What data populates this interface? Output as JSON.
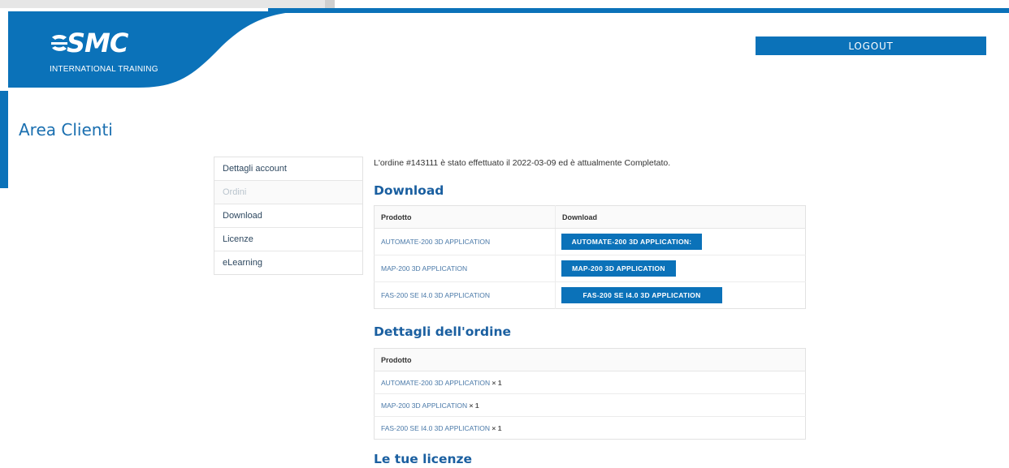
{
  "header": {
    "logo_text": "SMC",
    "logo_subtitle": "INTERNATIONAL TRAINING",
    "logout_label": "LOGOUT"
  },
  "page_title": "Area Clienti",
  "sidebar": {
    "items": [
      {
        "label": "Dettagli account"
      },
      {
        "label": "Ordini"
      },
      {
        "label": "Download"
      },
      {
        "label": "Licenze"
      },
      {
        "label": "eLearning"
      }
    ]
  },
  "order": {
    "prefix": "L'ordine #",
    "number": "143111",
    "middle": " è stato effettuato il ",
    "date": "2022-03-09",
    "middle2": " ed è attualmente ",
    "status": "Completato",
    "suffix": "."
  },
  "download": {
    "title": "Download",
    "columns": [
      "Prodotto",
      "Download"
    ],
    "rows": [
      {
        "product": "AUTOMATE-200 3D APPLICATION",
        "button": "AUTOMATE-200 3D APPLICATION:"
      },
      {
        "product": "MAP-200 3D APPLICATION",
        "button": "MAP-200 3D APPLICATION"
      },
      {
        "product": "FAS-200 SE I4.0 3D APPLICATION",
        "button": "FAS-200 SE I4.0 3D APPLICATION"
      }
    ]
  },
  "details": {
    "title": "Dettagli dell'ordine",
    "column": "Prodotto",
    "rows": [
      {
        "product": "AUTOMATE-200 3D APPLICATION",
        "qty": "× 1"
      },
      {
        "product": "MAP-200 3D APPLICATION",
        "qty": "× 1"
      },
      {
        "product": "FAS-200 SE I4.0 3D APPLICATION",
        "qty": "× 1"
      }
    ]
  },
  "licenses": {
    "title": "Le tue licenze"
  },
  "colors": {
    "brand_blue": "#0b72b9",
    "heading_blue": "#1a5fa0"
  }
}
